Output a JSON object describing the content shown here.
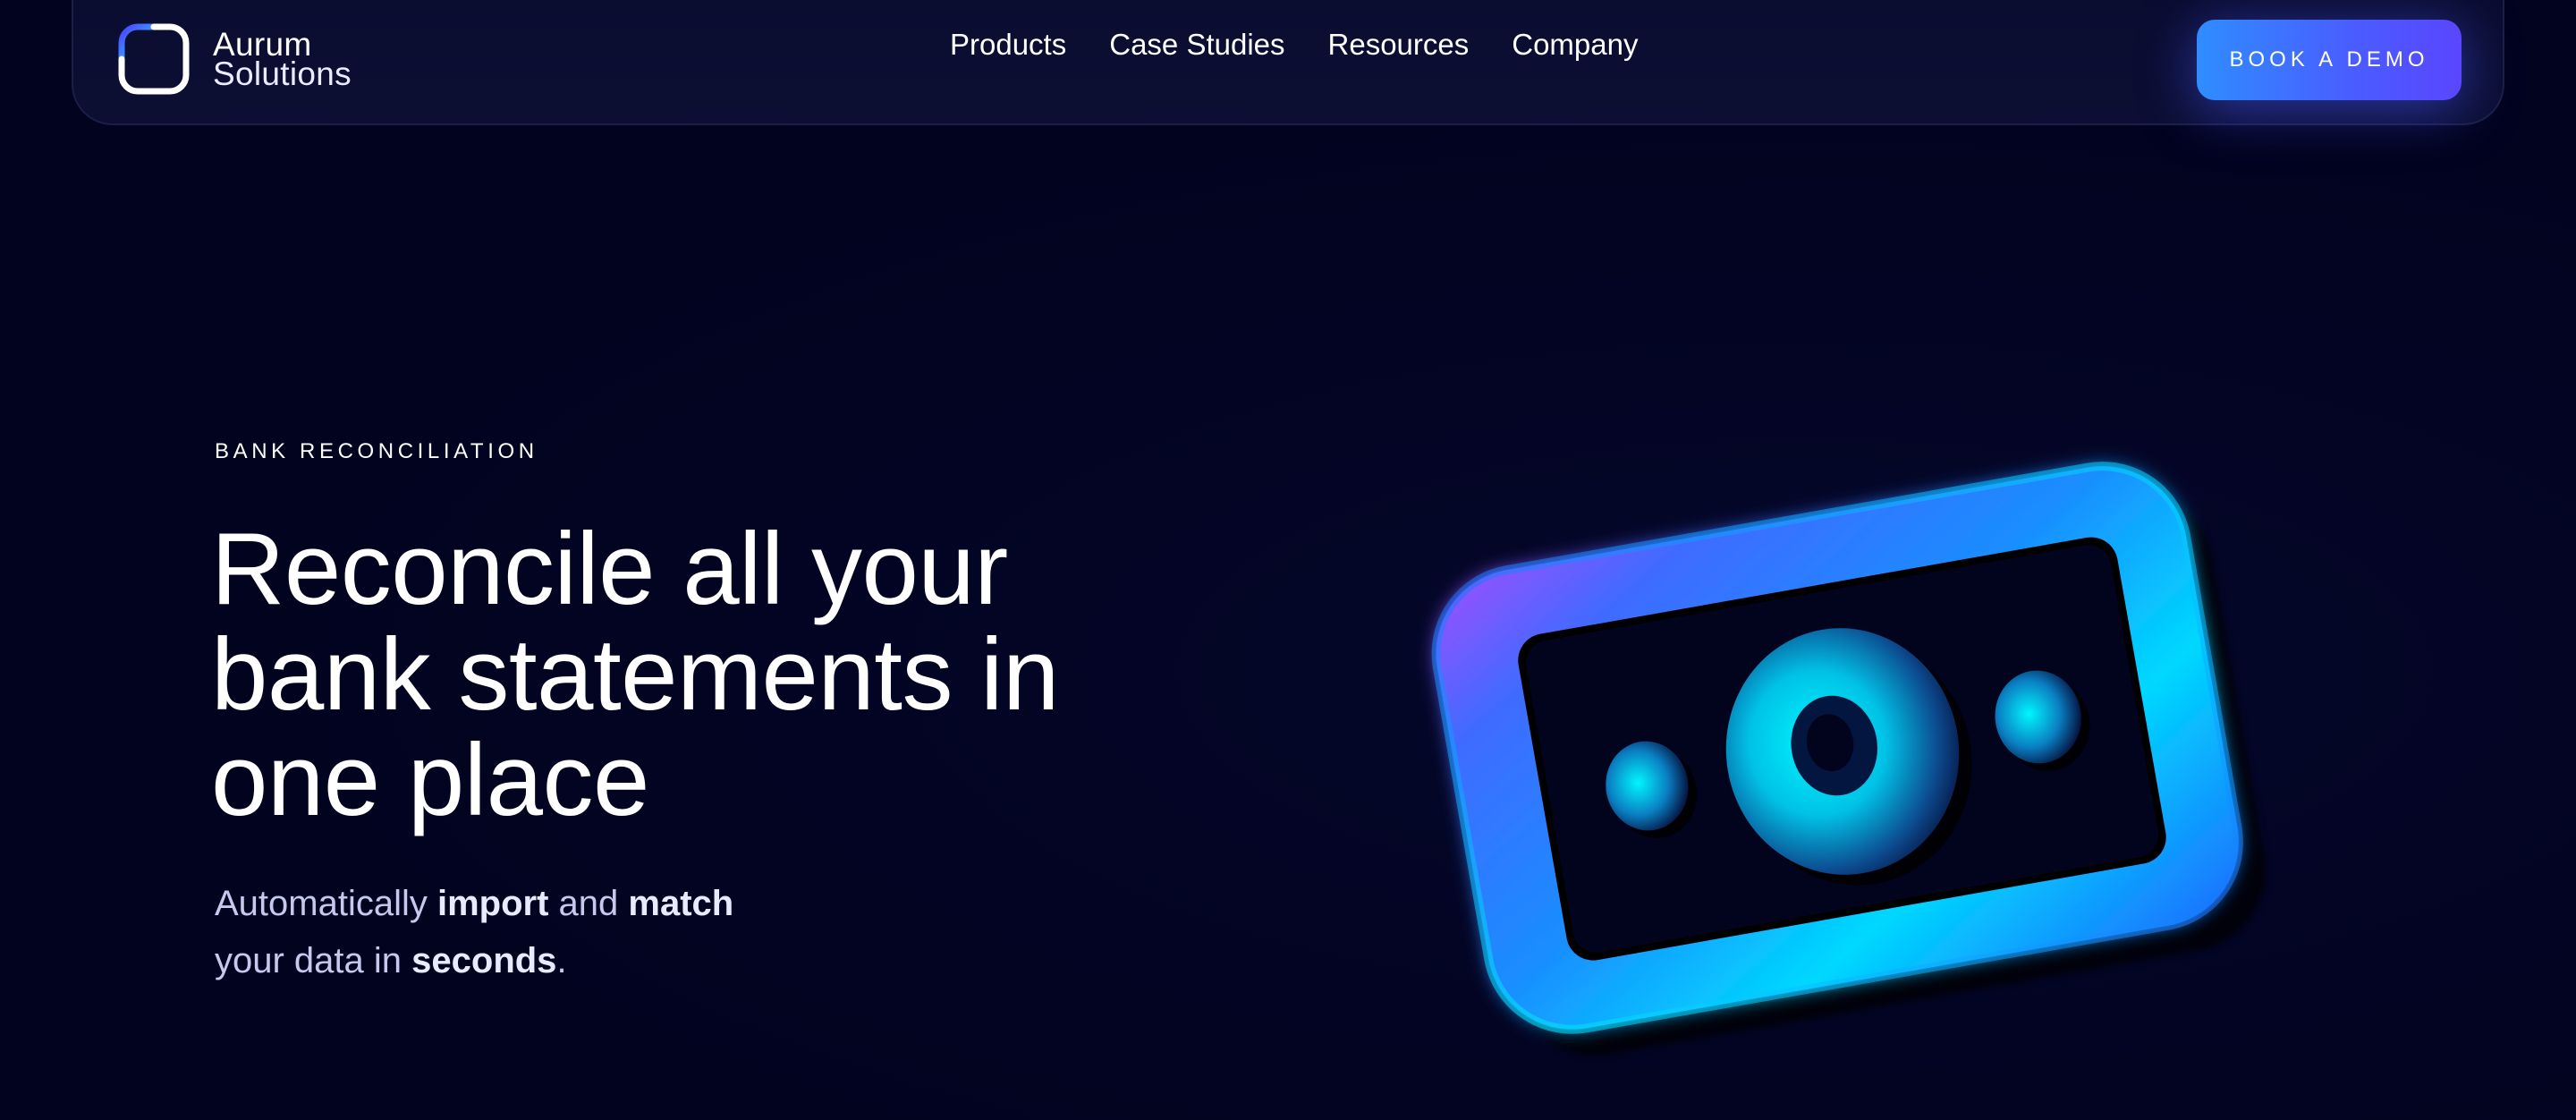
{
  "brand": {
    "line1": "Aurum",
    "line2": "Solutions",
    "accent_colors": [
      "#4b3fff",
      "#2fe0ff"
    ]
  },
  "nav": {
    "items": [
      {
        "label": "Products"
      },
      {
        "label": "Case Studies"
      },
      {
        "label": "Resources"
      },
      {
        "label": "Company"
      }
    ],
    "cta_label": "BOOK A DEMO",
    "cta_colors": [
      "#2f8dff",
      "#5a46ff"
    ]
  },
  "hero": {
    "eyebrow": "BANK RECONCILIATION",
    "headline_lines": [
      "Reconcile all your",
      "bank statements in",
      "one place"
    ],
    "sub_parts": [
      "Automatically ",
      "import",
      " and ",
      "match",
      "your data in ",
      "seconds",
      "."
    ],
    "illustration_icon": "banknote-3d-icon",
    "illustration_colors": [
      "#00e6ff",
      "#1a7dff",
      "#9b4dff"
    ]
  },
  "theme": {
    "background": "#02031f",
    "text": "#ffffff",
    "muted_text": "#c5c9ee"
  }
}
